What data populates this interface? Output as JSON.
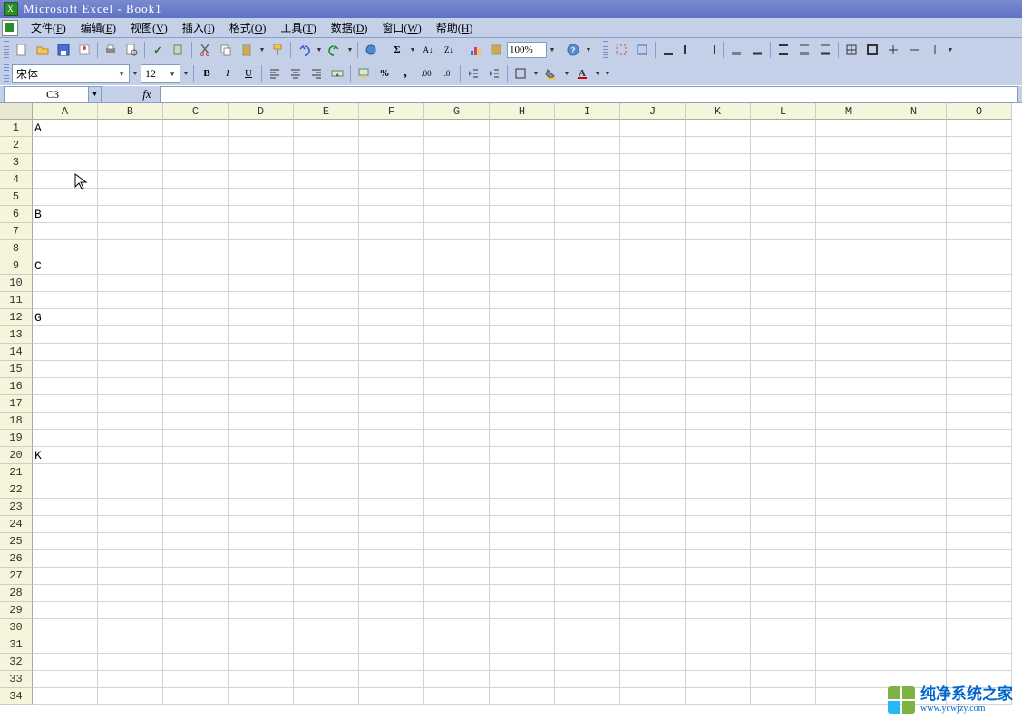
{
  "title": "Microsoft Excel - Book1",
  "menu": [
    {
      "label": "文件",
      "accel": "F"
    },
    {
      "label": "编辑",
      "accel": "E"
    },
    {
      "label": "视图",
      "accel": "V"
    },
    {
      "label": "插入",
      "accel": "I"
    },
    {
      "label": "格式",
      "accel": "O"
    },
    {
      "label": "工具",
      "accel": "T"
    },
    {
      "label": "数据",
      "accel": "D"
    },
    {
      "label": "窗口",
      "accel": "W"
    },
    {
      "label": "帮助",
      "accel": "H"
    }
  ],
  "font": {
    "name": "宋体",
    "size": "12"
  },
  "zoom": "100%",
  "namebox": "C3",
  "fx_label": "fx",
  "columns": [
    "A",
    "B",
    "C",
    "D",
    "E",
    "F",
    "G",
    "H",
    "I",
    "J",
    "K",
    "L",
    "M",
    "N",
    "O"
  ],
  "row_count": 34,
  "cells": {
    "A1": "A",
    "A6": "B",
    "A9": "C",
    "A12": "G",
    "A20": "K"
  },
  "watermark": {
    "cn": "纯净系统之家",
    "url": "www.ycwjzy.com"
  }
}
